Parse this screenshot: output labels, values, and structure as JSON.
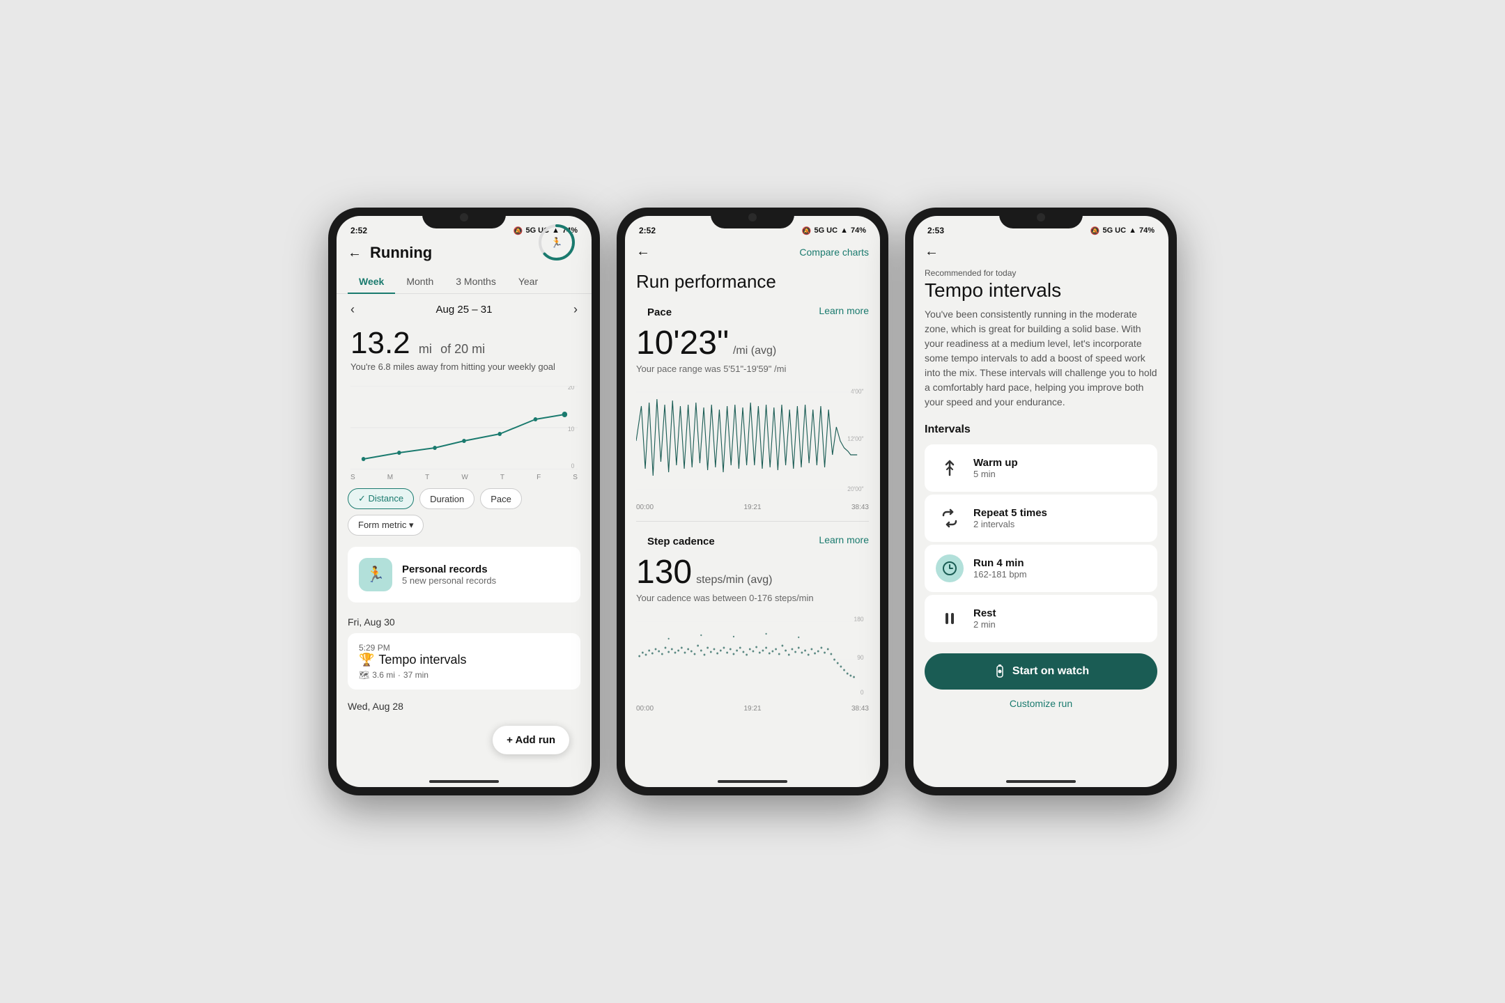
{
  "phone1": {
    "status": {
      "time": "2:52",
      "signal": "5G UC",
      "battery": "74%",
      "icon_wifi": "▲",
      "icon_battery": "▓"
    },
    "header": {
      "title": "Running",
      "back_label": "←"
    },
    "tabs": [
      {
        "label": "Week",
        "active": true
      },
      {
        "label": "Month",
        "active": false
      },
      {
        "label": "3 Months",
        "active": false
      },
      {
        "label": "Year",
        "active": false
      }
    ],
    "week_range": "Aug 25 – 31",
    "distance": {
      "current": "13.2",
      "unit": "mi",
      "goal": "of 20 mi",
      "description": "You're 6.8 miles away from hitting your weekly goal"
    },
    "chart_days": [
      "S",
      "M",
      "T",
      "W",
      "T",
      "F",
      "S"
    ],
    "chart_values": [
      2.5,
      4.0,
      5.2,
      6.8,
      8.5,
      12.0,
      13.2
    ],
    "chart_max": 20,
    "filters": [
      {
        "label": "Distance",
        "active": true,
        "check": "✓"
      },
      {
        "label": "Duration",
        "active": false
      },
      {
        "label": "Pace",
        "active": false
      },
      {
        "label": "Form metric ▾",
        "active": false
      }
    ],
    "personal_records": {
      "title": "Personal records",
      "subtitle": "5 new personal records"
    },
    "activity": {
      "date": "Fri, Aug 30",
      "time": "5:29 PM",
      "workout_icon": "🏆",
      "name": "Tempo intervals",
      "distance": "3.6 mi",
      "duration": "37 min"
    },
    "date2": "Wed, Aug 28",
    "add_run_label": "+ Add run"
  },
  "phone2": {
    "status": {
      "time": "2:52",
      "signal": "5G UC",
      "battery": "74%"
    },
    "header": {
      "back_label": "←",
      "compare_label": "Compare charts"
    },
    "title": "Run performance",
    "pace_section": {
      "label": "Pace",
      "learn_more": "Learn more",
      "value": "10'23\"",
      "unit": "/mi (avg)",
      "range": "Your pace range was 5'51\"-19'59\" /mi"
    },
    "chart1": {
      "time_labels": [
        "00:00",
        "19:21",
        "38:43"
      ],
      "y_labels": [
        "4'00\"",
        "12'00\"",
        "20'00\""
      ]
    },
    "cadence_section": {
      "label": "Step cadence",
      "learn_more": "Learn more",
      "value": "130",
      "unit": "steps/min (avg)",
      "range": "Your cadence was between 0-176 steps/min"
    },
    "chart2": {
      "time_labels": [
        "00:00",
        "19:21",
        "38:43"
      ],
      "y_labels": [
        "180",
        "90",
        "0"
      ]
    }
  },
  "phone3": {
    "status": {
      "time": "2:53",
      "signal": "5G UC",
      "battery": "74%"
    },
    "header": {
      "back_label": "←"
    },
    "recommended": "Recommended for today",
    "title": "Tempo intervals",
    "description": "You've been consistently running in the moderate zone, which is great for building a solid base. With your readiness at a medium level, let's incorporate some tempo intervals to add a boost of speed work into the mix. These intervals will challenge you to hold a comfortably hard pace, helping you improve both your speed and your endurance.",
    "intervals_label": "Intervals",
    "intervals": [
      {
        "icon": "↑",
        "icon_style": "arrow",
        "name": "Warm up",
        "detail": "5 min"
      },
      {
        "icon": "⇄",
        "icon_style": "repeat",
        "name": "Repeat 5 times",
        "detail": "2 intervals"
      },
      {
        "icon": "⏱",
        "icon_style": "teal",
        "name": "Run 4 min",
        "detail": "162-181 bpm"
      },
      {
        "icon": "⏸",
        "icon_style": "normal",
        "name": "Rest",
        "detail": "2 min"
      }
    ],
    "start_watch_label": "Start on watch",
    "customize_label": "Customize run"
  }
}
